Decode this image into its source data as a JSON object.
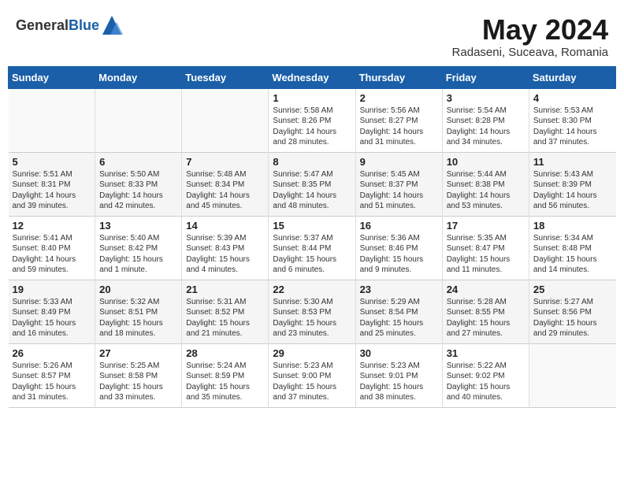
{
  "header": {
    "logo_general": "General",
    "logo_blue": "Blue",
    "month_title": "May 2024",
    "subtitle": "Radaseni, Suceava, Romania"
  },
  "days_of_week": [
    "Sunday",
    "Monday",
    "Tuesday",
    "Wednesday",
    "Thursday",
    "Friday",
    "Saturday"
  ],
  "weeks": [
    [
      {
        "day": "",
        "sunrise": "",
        "sunset": "",
        "daylight": ""
      },
      {
        "day": "",
        "sunrise": "",
        "sunset": "",
        "daylight": ""
      },
      {
        "day": "",
        "sunrise": "",
        "sunset": "",
        "daylight": ""
      },
      {
        "day": "1",
        "sunrise": "Sunrise: 5:58 AM",
        "sunset": "Sunset: 8:26 PM",
        "daylight": "Daylight: 14 hours and 28 minutes."
      },
      {
        "day": "2",
        "sunrise": "Sunrise: 5:56 AM",
        "sunset": "Sunset: 8:27 PM",
        "daylight": "Daylight: 14 hours and 31 minutes."
      },
      {
        "day": "3",
        "sunrise": "Sunrise: 5:54 AM",
        "sunset": "Sunset: 8:28 PM",
        "daylight": "Daylight: 14 hours and 34 minutes."
      },
      {
        "day": "4",
        "sunrise": "Sunrise: 5:53 AM",
        "sunset": "Sunset: 8:30 PM",
        "daylight": "Daylight: 14 hours and 37 minutes."
      }
    ],
    [
      {
        "day": "5",
        "sunrise": "Sunrise: 5:51 AM",
        "sunset": "Sunset: 8:31 PM",
        "daylight": "Daylight: 14 hours and 39 minutes."
      },
      {
        "day": "6",
        "sunrise": "Sunrise: 5:50 AM",
        "sunset": "Sunset: 8:33 PM",
        "daylight": "Daylight: 14 hours and 42 minutes."
      },
      {
        "day": "7",
        "sunrise": "Sunrise: 5:48 AM",
        "sunset": "Sunset: 8:34 PM",
        "daylight": "Daylight: 14 hours and 45 minutes."
      },
      {
        "day": "8",
        "sunrise": "Sunrise: 5:47 AM",
        "sunset": "Sunset: 8:35 PM",
        "daylight": "Daylight: 14 hours and 48 minutes."
      },
      {
        "day": "9",
        "sunrise": "Sunrise: 5:45 AM",
        "sunset": "Sunset: 8:37 PM",
        "daylight": "Daylight: 14 hours and 51 minutes."
      },
      {
        "day": "10",
        "sunrise": "Sunrise: 5:44 AM",
        "sunset": "Sunset: 8:38 PM",
        "daylight": "Daylight: 14 hours and 53 minutes."
      },
      {
        "day": "11",
        "sunrise": "Sunrise: 5:43 AM",
        "sunset": "Sunset: 8:39 PM",
        "daylight": "Daylight: 14 hours and 56 minutes."
      }
    ],
    [
      {
        "day": "12",
        "sunrise": "Sunrise: 5:41 AM",
        "sunset": "Sunset: 8:40 PM",
        "daylight": "Daylight: 14 hours and 59 minutes."
      },
      {
        "day": "13",
        "sunrise": "Sunrise: 5:40 AM",
        "sunset": "Sunset: 8:42 PM",
        "daylight": "Daylight: 15 hours and 1 minute."
      },
      {
        "day": "14",
        "sunrise": "Sunrise: 5:39 AM",
        "sunset": "Sunset: 8:43 PM",
        "daylight": "Daylight: 15 hours and 4 minutes."
      },
      {
        "day": "15",
        "sunrise": "Sunrise: 5:37 AM",
        "sunset": "Sunset: 8:44 PM",
        "daylight": "Daylight: 15 hours and 6 minutes."
      },
      {
        "day": "16",
        "sunrise": "Sunrise: 5:36 AM",
        "sunset": "Sunset: 8:46 PM",
        "daylight": "Daylight: 15 hours and 9 minutes."
      },
      {
        "day": "17",
        "sunrise": "Sunrise: 5:35 AM",
        "sunset": "Sunset: 8:47 PM",
        "daylight": "Daylight: 15 hours and 11 minutes."
      },
      {
        "day": "18",
        "sunrise": "Sunrise: 5:34 AM",
        "sunset": "Sunset: 8:48 PM",
        "daylight": "Daylight: 15 hours and 14 minutes."
      }
    ],
    [
      {
        "day": "19",
        "sunrise": "Sunrise: 5:33 AM",
        "sunset": "Sunset: 8:49 PM",
        "daylight": "Daylight: 15 hours and 16 minutes."
      },
      {
        "day": "20",
        "sunrise": "Sunrise: 5:32 AM",
        "sunset": "Sunset: 8:51 PM",
        "daylight": "Daylight: 15 hours and 18 minutes."
      },
      {
        "day": "21",
        "sunrise": "Sunrise: 5:31 AM",
        "sunset": "Sunset: 8:52 PM",
        "daylight": "Daylight: 15 hours and 21 minutes."
      },
      {
        "day": "22",
        "sunrise": "Sunrise: 5:30 AM",
        "sunset": "Sunset: 8:53 PM",
        "daylight": "Daylight: 15 hours and 23 minutes."
      },
      {
        "day": "23",
        "sunrise": "Sunrise: 5:29 AM",
        "sunset": "Sunset: 8:54 PM",
        "daylight": "Daylight: 15 hours and 25 minutes."
      },
      {
        "day": "24",
        "sunrise": "Sunrise: 5:28 AM",
        "sunset": "Sunset: 8:55 PM",
        "daylight": "Daylight: 15 hours and 27 minutes."
      },
      {
        "day": "25",
        "sunrise": "Sunrise: 5:27 AM",
        "sunset": "Sunset: 8:56 PM",
        "daylight": "Daylight: 15 hours and 29 minutes."
      }
    ],
    [
      {
        "day": "26",
        "sunrise": "Sunrise: 5:26 AM",
        "sunset": "Sunset: 8:57 PM",
        "daylight": "Daylight: 15 hours and 31 minutes."
      },
      {
        "day": "27",
        "sunrise": "Sunrise: 5:25 AM",
        "sunset": "Sunset: 8:58 PM",
        "daylight": "Daylight: 15 hours and 33 minutes."
      },
      {
        "day": "28",
        "sunrise": "Sunrise: 5:24 AM",
        "sunset": "Sunset: 8:59 PM",
        "daylight": "Daylight: 15 hours and 35 minutes."
      },
      {
        "day": "29",
        "sunrise": "Sunrise: 5:23 AM",
        "sunset": "Sunset: 9:00 PM",
        "daylight": "Daylight: 15 hours and 37 minutes."
      },
      {
        "day": "30",
        "sunrise": "Sunrise: 5:23 AM",
        "sunset": "Sunset: 9:01 PM",
        "daylight": "Daylight: 15 hours and 38 minutes."
      },
      {
        "day": "31",
        "sunrise": "Sunrise: 5:22 AM",
        "sunset": "Sunset: 9:02 PM",
        "daylight": "Daylight: 15 hours and 40 minutes."
      },
      {
        "day": "",
        "sunrise": "",
        "sunset": "",
        "daylight": ""
      }
    ]
  ]
}
